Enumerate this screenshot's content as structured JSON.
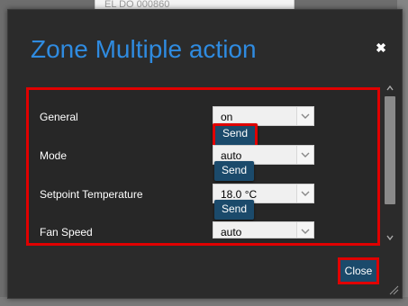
{
  "background": {
    "fragment_text": "EL DO 000860"
  },
  "dialog": {
    "title": "Zone Multiple action",
    "close_icon_glyph": "✖",
    "rows": [
      {
        "label": "General",
        "value": "on"
      },
      {
        "label": "Mode",
        "value": "auto"
      },
      {
        "label": "Setpoint Temperature",
        "value": "18.0 °C"
      },
      {
        "label": "Fan Speed",
        "value": "auto"
      }
    ],
    "send_label": "Send",
    "close_label": "Close"
  },
  "colors": {
    "title": "#2f8be0",
    "dialog_bg": "#2b2b2b",
    "button_bg": "#1b4a6b",
    "highlight": "#e00000"
  }
}
